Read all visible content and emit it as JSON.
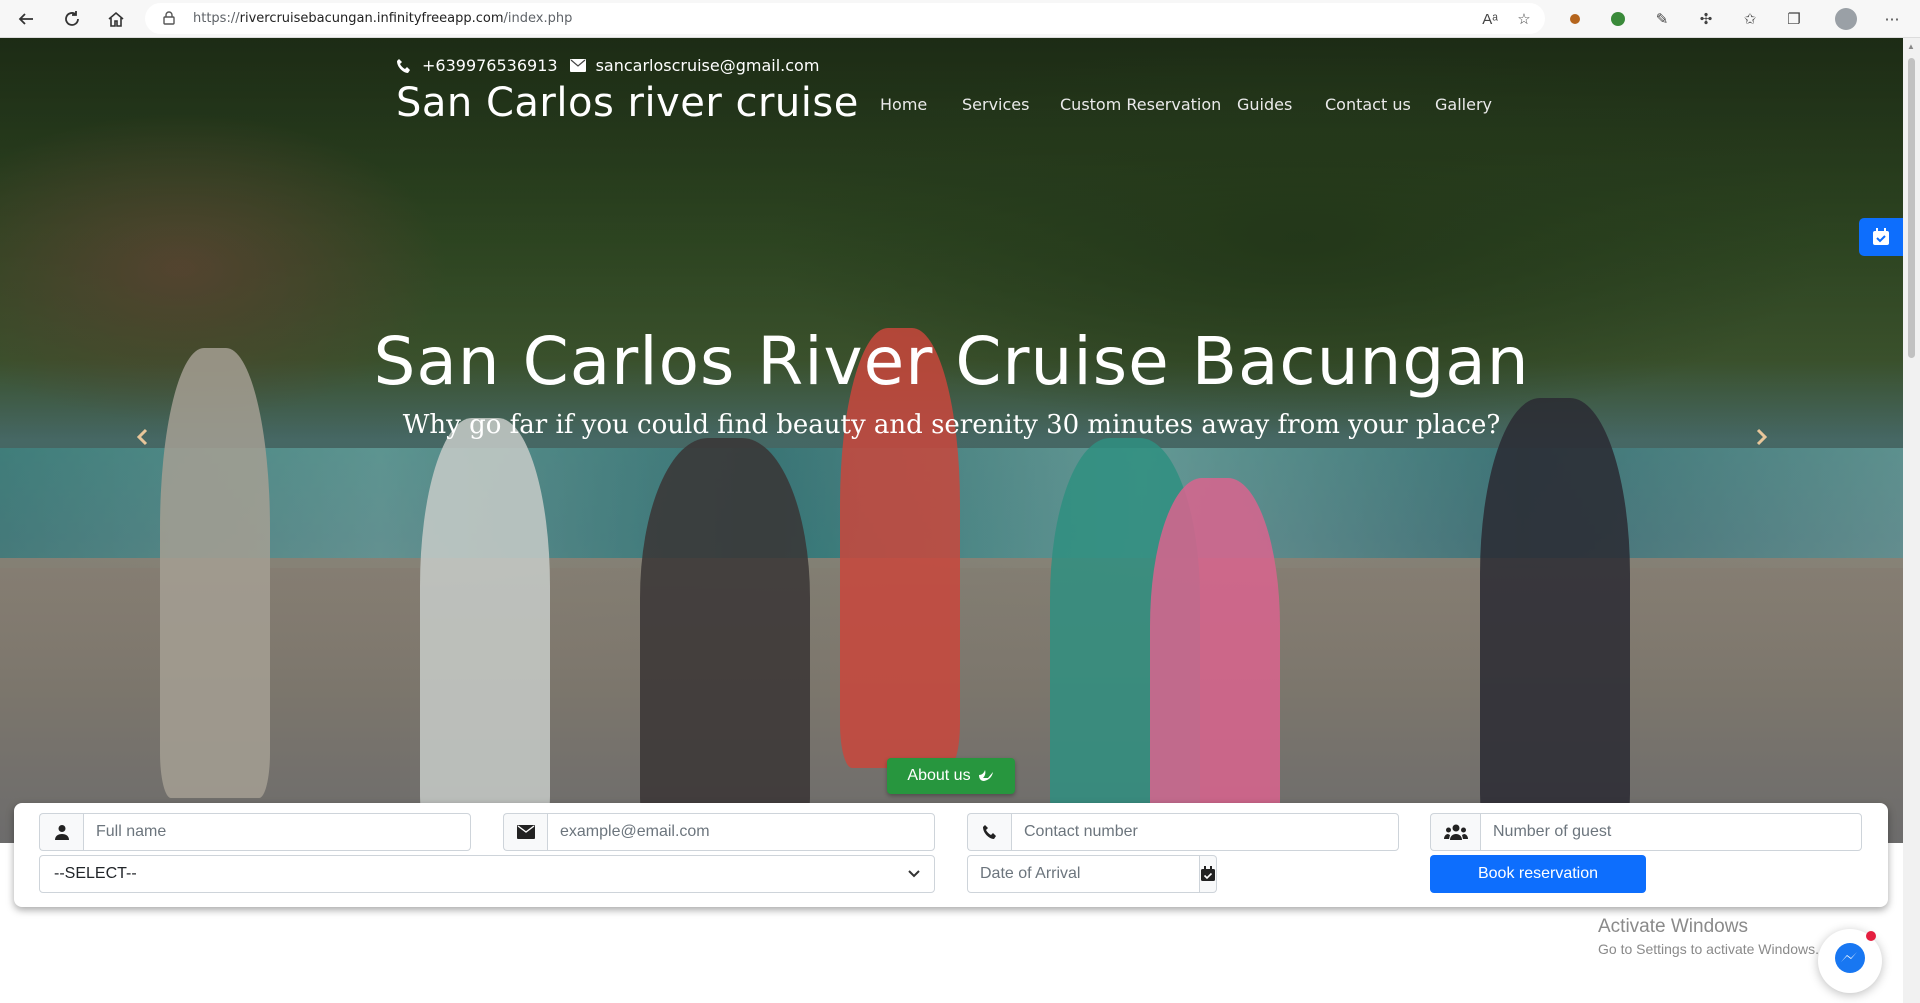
{
  "browser": {
    "url_prefix": "https://",
    "url_domain": "rivercruisebacungan.infinityfreeapp.com",
    "url_path": "/index.php"
  },
  "contact": {
    "phone": "+639976536913",
    "email": "sancarloscruise@gmail.com"
  },
  "brand": "San Carlos river cruise",
  "menu": [
    "Home",
    "Services",
    "Custom Reservation",
    "Guides",
    "Contact us",
    "Gallery"
  ],
  "hero": {
    "title": "San Carlos River Cruise Bacungan",
    "subtitle": "Why go far if you could find beauty and serenity 30 minutes away from your place?",
    "about_button": "About us"
  },
  "form": {
    "full_name_placeholder": "Full name",
    "email_placeholder": "example@email.com",
    "contact_placeholder": "Contact number",
    "guests_placeholder": "Number of guest",
    "select_value": "--SELECT--",
    "arrival_placeholder": "Date of Arrival",
    "book_button": "Book reservation"
  },
  "windows": {
    "line1": "Activate Windows",
    "line2": "Go to Settings to activate Windows."
  },
  "colors": {
    "primary": "#0d6efd",
    "success": "#27963e"
  }
}
